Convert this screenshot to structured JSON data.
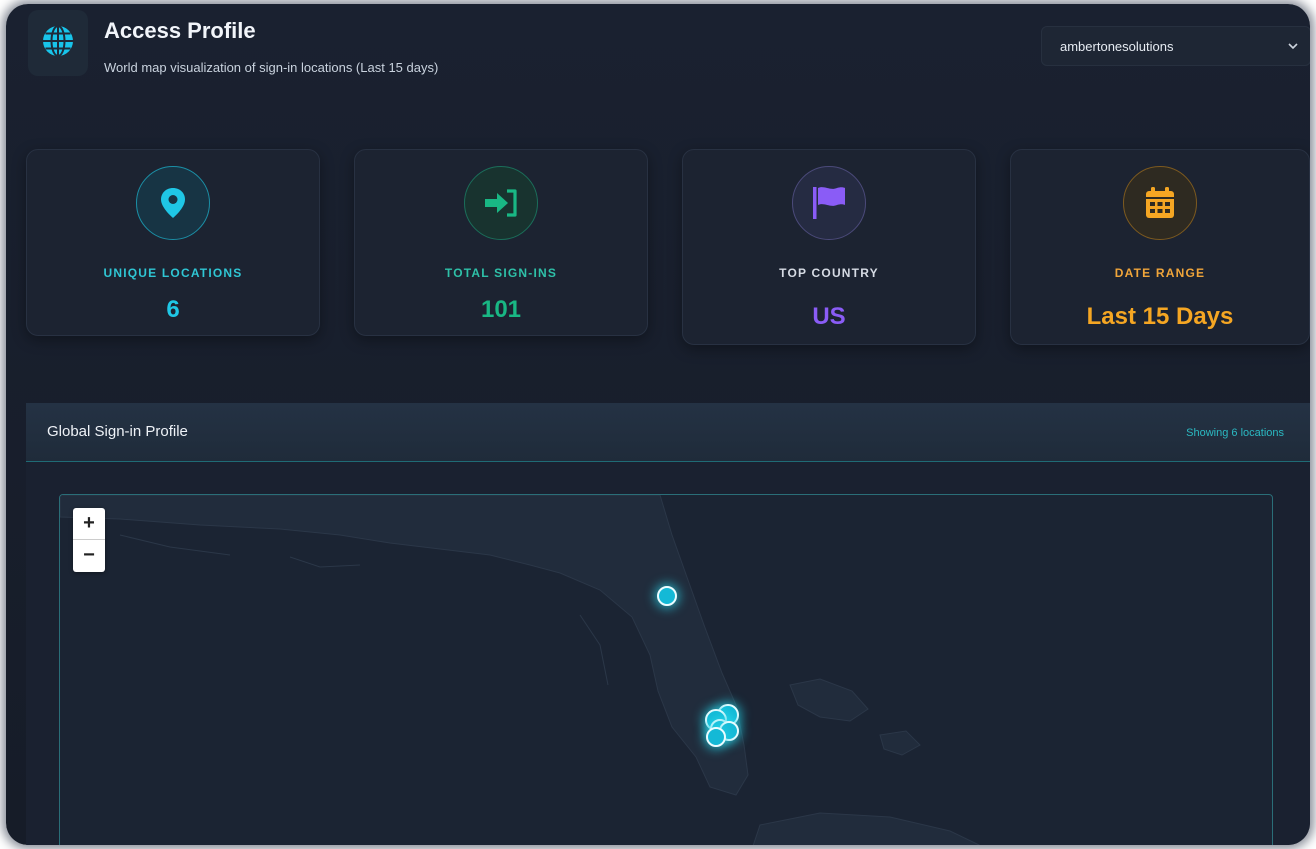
{
  "header": {
    "title": "Access Profile",
    "subtitle": "World map visualization of sign-in locations (Last 15 days)",
    "logo_icon": "globe-icon",
    "tenant_select": {
      "value": "ambertonesolutions",
      "icon": "chevron-down-icon"
    }
  },
  "stats": [
    {
      "label": "UNIQUE LOCATIONS",
      "value": "6",
      "icon": "map-pin-icon",
      "color": "#1fc7e6"
    },
    {
      "label": "TOTAL SIGN-INS",
      "value": "101",
      "icon": "sign-in-icon",
      "color": "#19b784"
    },
    {
      "label": "TOP COUNTRY",
      "value": "US",
      "icon": "flag-icon",
      "color": "#8a5cf6"
    },
    {
      "label": "DATE RANGE",
      "value": "Last 15 Days",
      "icon": "calendar-icon",
      "color": "#f5a623"
    }
  ],
  "map_panel": {
    "title": "Global Sign-in Profile",
    "meta": "Showing 6 locations",
    "zoom_in": "+",
    "zoom_out": "−",
    "marker_color": "#14b9d6"
  }
}
